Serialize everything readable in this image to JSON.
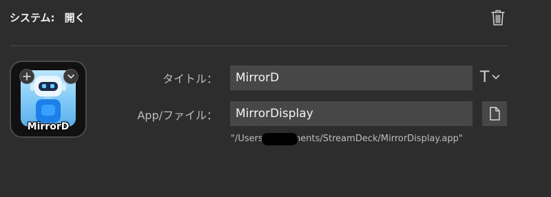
{
  "header": {
    "label": "システム:",
    "action": "開く"
  },
  "key": {
    "caption": "MirrorD"
  },
  "form": {
    "title_label": "タイトル：",
    "title_value": "MirrorD",
    "app_label": "App/ファイル：",
    "app_value": "MirrorDisplay",
    "font_button": "T"
  },
  "path": {
    "text": "\"/Users/        Documents/StreamDeck/MirrorDisplay.app\""
  },
  "icons": {
    "trash": "trash-icon",
    "add": "plus-icon",
    "chevron": "chevron-down-icon",
    "file": "document-icon"
  }
}
